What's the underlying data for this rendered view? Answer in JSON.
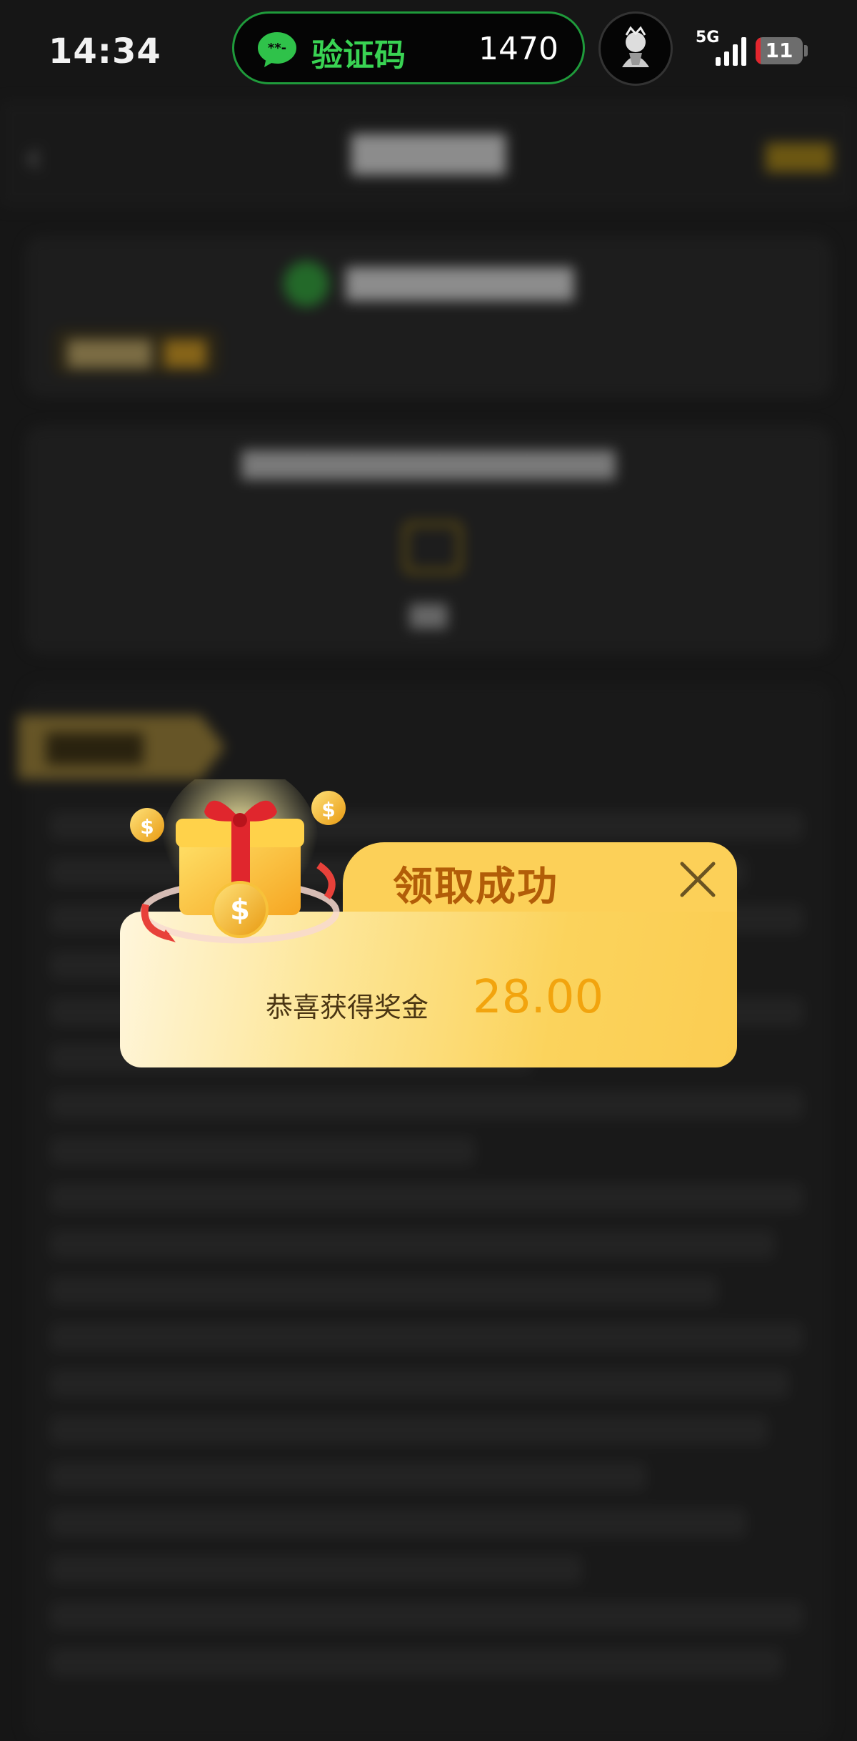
{
  "status_bar": {
    "time": "14:34",
    "notification": {
      "icon": "wechat-icon",
      "label": "验证码",
      "code": "1470",
      "accent": "#39d353"
    },
    "network": "5G",
    "battery": "11"
  },
  "modal": {
    "title": "领取成功",
    "message": "恭喜获得奖金",
    "amount": "28.00",
    "colors": {
      "title": "#b25d08",
      "amount": "#f2a40e",
      "background": "#fcd058"
    }
  }
}
